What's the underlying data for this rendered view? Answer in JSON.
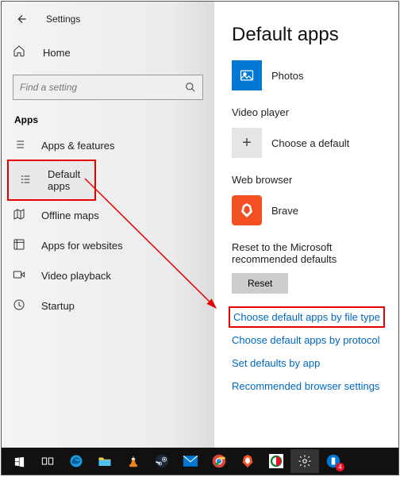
{
  "header": {
    "title": "Settings"
  },
  "sidebar": {
    "home": "Home",
    "search_placeholder": "Find a setting",
    "section": "Apps",
    "items": [
      "Apps & features",
      "Default apps",
      "Offline maps",
      "Apps for websites",
      "Video playback",
      "Startup"
    ]
  },
  "main": {
    "title": "Default apps",
    "photo_viewer": "Photos",
    "video_heading": "Video player",
    "video_default": "Choose a default",
    "browser_heading": "Web browser",
    "browser_default": "Brave",
    "reset_label": "Reset to the Microsoft recommended defaults",
    "reset_button": "Reset",
    "links": [
      "Choose default apps by file type",
      "Choose default apps by protocol",
      "Set defaults by app",
      "Recommended browser settings"
    ]
  },
  "taskbar": {
    "badge": "4"
  },
  "annotations": {
    "highlight_nav": "Default apps",
    "highlight_link": "Choose default apps by file type",
    "arrow_from": "Default apps",
    "arrow_to": "Choose default apps by file type"
  }
}
